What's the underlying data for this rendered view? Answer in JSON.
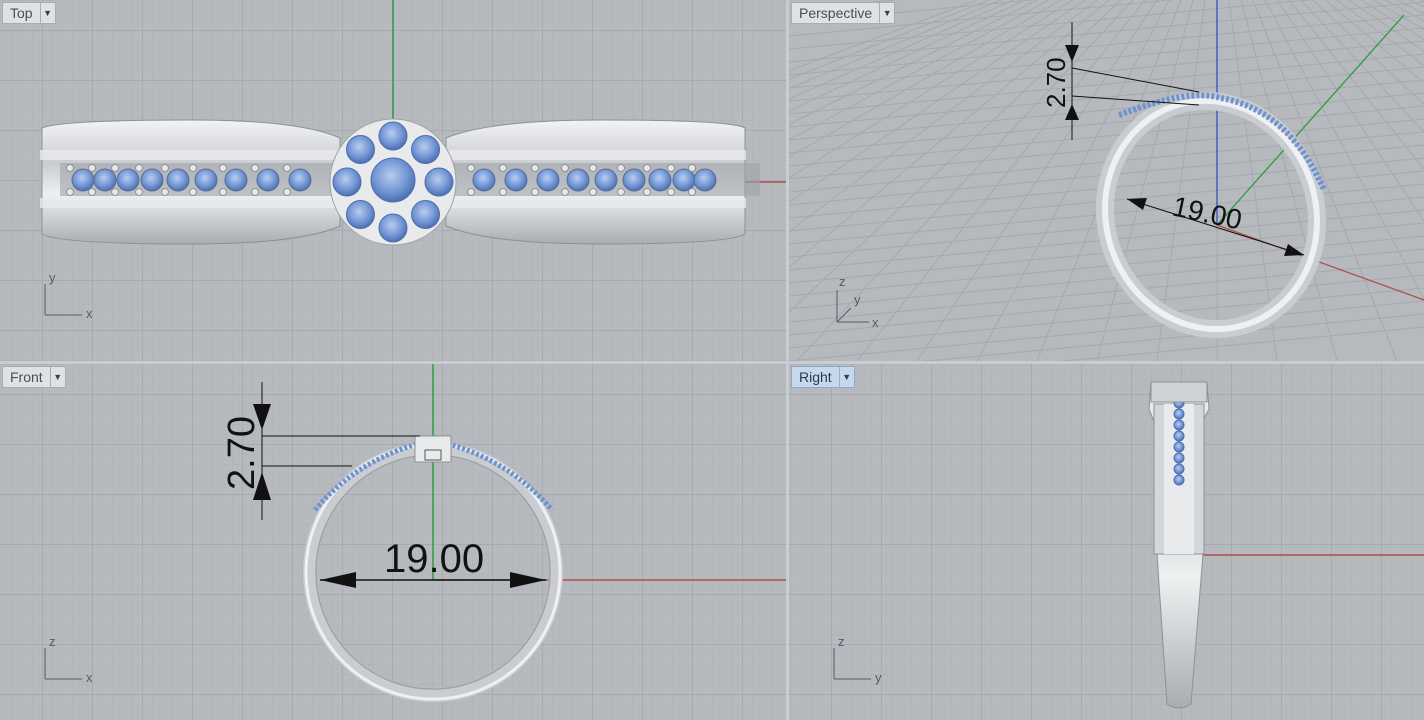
{
  "viewports": {
    "top": {
      "label": "Top",
      "axes": {
        "first": "y",
        "second": "x"
      }
    },
    "perspective": {
      "label": "Perspective",
      "axes": {
        "vertical": "z",
        "depth": "y",
        "horizontal": "x"
      },
      "dim_height": "2.70",
      "dim_diameter": "19.00"
    },
    "front": {
      "label": "Front",
      "axes": {
        "first": "z",
        "second": "x"
      },
      "dim_height": "2.70",
      "dim_diameter": "19.00"
    },
    "right": {
      "label": "Right",
      "active": true,
      "axes": {
        "first": "z",
        "second": "y"
      }
    }
  },
  "colors": {
    "viewport_bg": "#b4b8bd",
    "grid_minor": "#a9adb2",
    "grid_major": "#9ea2a7",
    "axis_x": "#c0392b",
    "axis_y": "#2e9e3a",
    "axis_z": "#3a4fbf",
    "metal": "#d9dcdf",
    "gem": "#6f93d1"
  },
  "icons": {
    "viewport_menu": "triangle-down-icon"
  }
}
